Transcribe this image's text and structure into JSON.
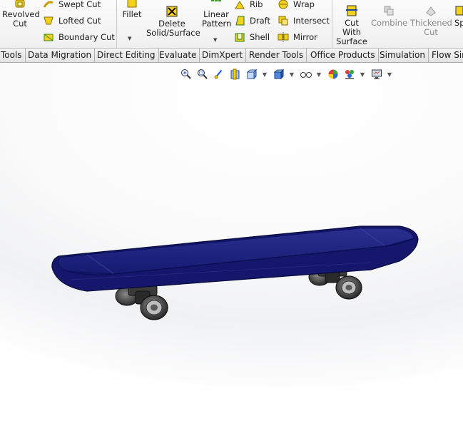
{
  "ribbon": {
    "revolved_cut": "Revolved\nCut",
    "swept_cut": "Swept Cut",
    "lofted_cut": "Lofted Cut",
    "boundary_cut": "Boundary Cut",
    "fillet": "Fillet",
    "delete_solid": "Delete\nSolid/Surface",
    "linear_pattern": "Linear\nPattern",
    "rib": "Rib",
    "draft": "Draft",
    "shell": "Shell",
    "wrap": "Wrap",
    "intersect": "Intersect",
    "mirror": "Mirror",
    "cut_with_surface": "Cut\nWith\nSurface",
    "combine": "Combine",
    "thickened_cut": "Thickened\nCut",
    "split_partial": "Sp"
  },
  "tabs": [
    "Tools",
    "Data Migration",
    "Direct Editing",
    "Evaluate",
    "DimXpert",
    "Render Tools",
    "Office Products",
    "Simulation",
    "Flow Sim"
  ],
  "colors": {
    "deck": "#14176b",
    "deck_light": "#2a2e8c",
    "wheel": "#2b2b2b",
    "truck": "#3a3a3a"
  }
}
